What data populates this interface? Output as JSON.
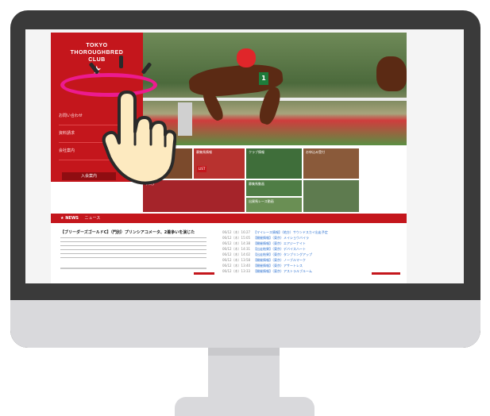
{
  "site": {
    "logo_line1": "TOKYO",
    "logo_line2": "THOROUGHBRED",
    "logo_line3": "CLUB",
    "logo_star": "★",
    "sidebar_items": [
      "お問い合わせ",
      "資料請求",
      "会社案内"
    ],
    "join_button": "入会案内",
    "hero_number": "1",
    "tiles": [
      "募集馬情報",
      "LIST",
      "クラブ情報",
      "お申込み受付",
      "ブログ",
      "募集馬動画",
      "出資馬レース動画"
    ],
    "news": {
      "badge": "★ NEWS",
      "label": "ニュース",
      "headline": "【ブリーダーズゴールドC】（門別）プリンシアコメータ、2着争いを演じた",
      "items": [
        {
          "date": "06/12（木）16:27",
          "title": "【マイレース情報】（地方）サウンドスカイ出走予定"
        },
        {
          "date": "06/12（木）15:05",
          "title": "【開催情報】（東京）メイショウバイラ"
        },
        {
          "date": "06/12（木）14:38",
          "title": "【開催情報】（東京）エアジーナイト"
        },
        {
          "date": "06/12（木）14:31",
          "title": "【出走結果】（東京）デバイスハート"
        },
        {
          "date": "06/12（木）14:02",
          "title": "【出走結果】（東京）タンブリングアップ"
        },
        {
          "date": "06/12（木）13:58",
          "title": "【開催情報】（東京）ノーブルマーク"
        },
        {
          "date": "06/12（木）13:40",
          "title": "【開催情報】（東京）アサートレス"
        },
        {
          "date": "06/12（木）13:33",
          "title": "【開催情報】（東京）アストラルブルーム"
        }
      ]
    }
  },
  "colors": {
    "brand_red": "#c4161c",
    "highlight_pink": "#ec1b8f",
    "bezel": "#3a3a3a",
    "monitor_silver": "#d9d9dc",
    "hand_fill": "#fdeac0"
  },
  "icons": [
    "tap-hand-icon",
    "highlight-ellipse"
  ]
}
